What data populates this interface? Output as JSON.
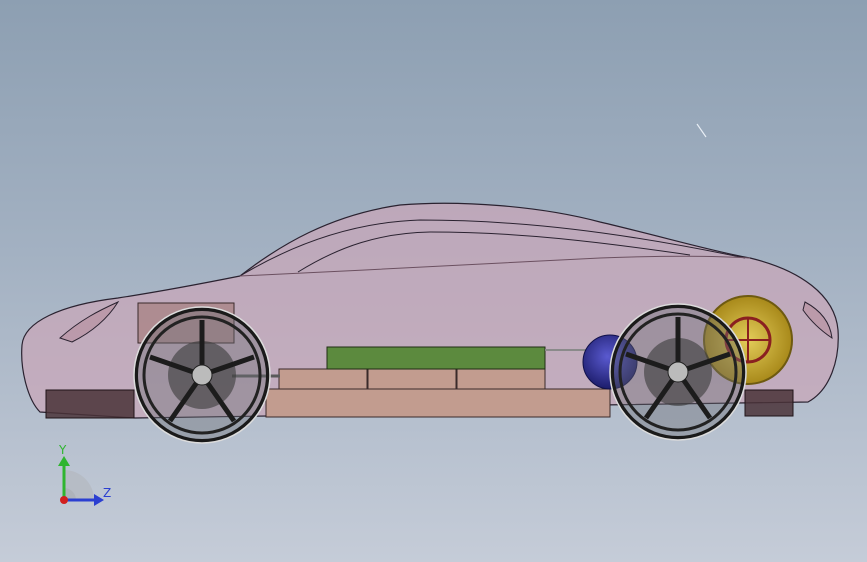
{
  "viewport": {
    "background_top": "#8d9fb2",
    "background_bottom": "#c5ccd8"
  },
  "model": {
    "body_color": "#c9a6b8",
    "battery_color": "#5c8a3e",
    "pack_color": "#c29c8f",
    "motor_front_color": "#2a2a86",
    "motor_rear_color": "#c9a928",
    "wheel_color": "#2a2a2a"
  },
  "triad": {
    "y_label": "Y",
    "z_label": "Z",
    "y_color": "#2fb52f",
    "z_color": "#2b3fd1",
    "x_color": "#d11f1f",
    "icon": "coordinate-triad-icon"
  }
}
